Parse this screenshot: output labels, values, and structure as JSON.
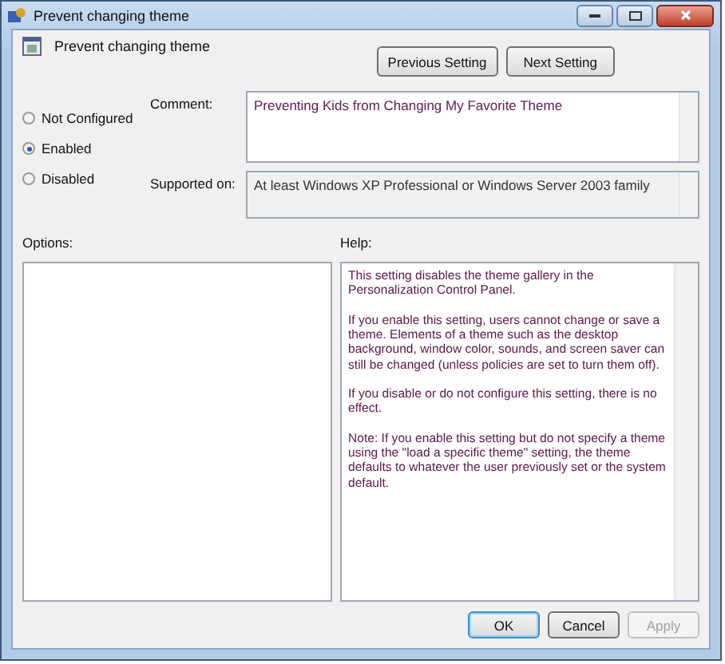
{
  "window": {
    "title": "Prevent changing theme"
  },
  "header": {
    "title": "Prevent changing theme",
    "buttons": [
      "Previous Setting",
      "Next Setting"
    ]
  },
  "state_options": [
    {
      "label": "Not Configured",
      "selected": false
    },
    {
      "label": "Enabled",
      "selected": true
    },
    {
      "label": "Disabled",
      "selected": false
    }
  ],
  "comment": {
    "label": "Comment:",
    "value": "Preventing Kids from Changing My Favorite Theme"
  },
  "supported_on": {
    "label": "Supported on:",
    "value": "At least Windows XP Professional or Windows Server 2003 family"
  },
  "options": {
    "label": "Options:"
  },
  "help": {
    "label": "Help:",
    "paragraphs": [
      "This setting disables the theme gallery in the Personalization Control Panel.",
      "If you enable this setting, users cannot change or save a theme. Elements of a theme such as the desktop background, window color, sounds, and screen saver can still be changed (unless policies are set to turn them off).",
      "If you disable or do not configure this setting, there is no effect.",
      "Note: If you enable this setting but do not specify a theme using the \"load a specific theme\" setting, the theme defaults to whatever the user previously set or the system default."
    ]
  },
  "footer_buttons": [
    {
      "label": "OK",
      "disabled": false,
      "default": true
    },
    {
      "label": "Cancel",
      "disabled": false,
      "default": false
    },
    {
      "label": "Apply",
      "disabled": true,
      "default": false
    }
  ]
}
